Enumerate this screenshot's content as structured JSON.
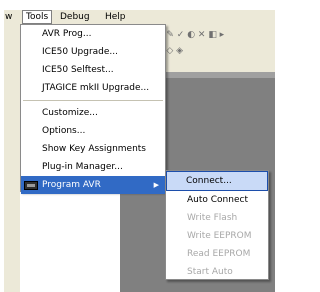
{
  "menubar": {
    "items": [
      {
        "label": "w"
      },
      {
        "label": "Tools"
      },
      {
        "label": "Debug"
      },
      {
        "label": "Help"
      }
    ]
  },
  "tools_menu": {
    "items": [
      {
        "label": "AVR Prog..."
      },
      {
        "label": "ICE50 Upgrade..."
      },
      {
        "label": "ICE50 Selftest..."
      },
      {
        "label": "JTAGICE mkII Upgrade..."
      },
      {
        "label": "Customize..."
      },
      {
        "label": "Options..."
      },
      {
        "label": "Show Key Assignments"
      },
      {
        "label": "Plug-in Manager..."
      },
      {
        "label": "Program AVR"
      }
    ]
  },
  "program_submenu": {
    "items": [
      {
        "label": "Connect...",
        "enabled": true
      },
      {
        "label": "Auto Connect",
        "enabled": true
      },
      {
        "label": "Write Flash",
        "enabled": false
      },
      {
        "label": "Write EEPROM",
        "enabled": false
      },
      {
        "label": "Read EEPROM",
        "enabled": false
      },
      {
        "label": "Start Auto",
        "enabled": false
      }
    ]
  },
  "icons": {
    "program_avr": "chip-icon",
    "submenu_arrow": "chevron-right-icon"
  },
  "colors": {
    "selection": "#316ac5",
    "menubar": "#ece9d8",
    "workspace": "#808080"
  }
}
